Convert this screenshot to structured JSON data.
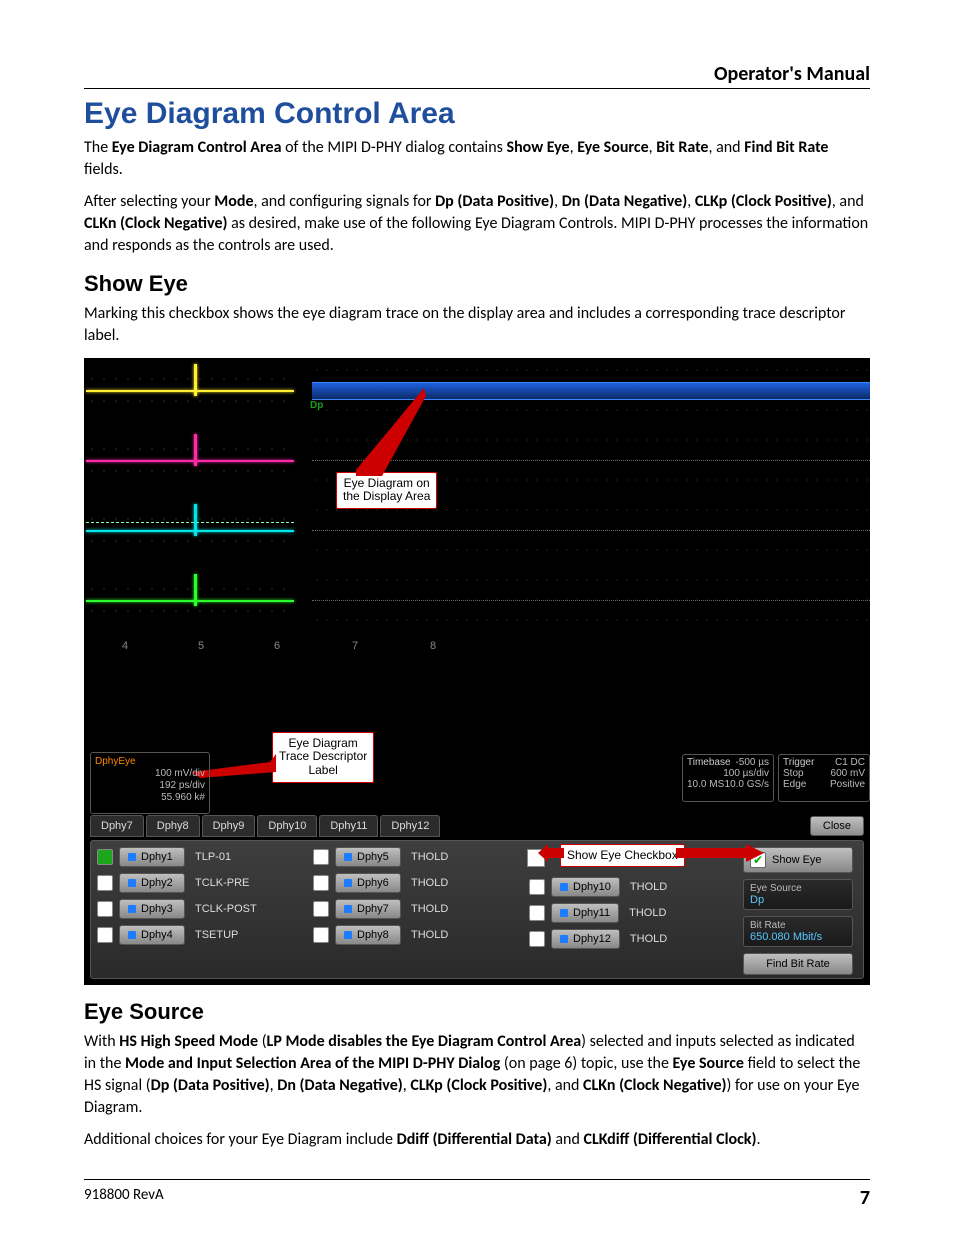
{
  "doc": {
    "category": "Operator's Manual",
    "title": "Eye Diagram Control Area",
    "p1a": "The ",
    "p1b": "Eye Diagram Control Area",
    "p1c": " of the MIPI D-PHY dialog contains ",
    "p1d": "Show Eye",
    "p1e": ", ",
    "p1f": "Eye Source",
    "p1g": ", ",
    "p1h": "Bit Rate",
    "p1i": ", and ",
    "p1j": "Find Bit Rate",
    "p1k": " fields.",
    "p2a": "After selecting your ",
    "p2b": "Mode",
    "p2c": ", and configuring signals for ",
    "p2d": "Dp (Data Positive)",
    "p2e": ", ",
    "p2f": "Dn (Data Negative)",
    "p2g": ", ",
    "p2h": "CLKp (Clock Positive)",
    "p2i": ", and ",
    "p2j": "CLKn (Clock Negative)",
    "p2k": " as desired, make use of the following Eye Diagram Controls. MIPI D-PHY processes the information and responds as the controls are used.",
    "h_showeye": "Show Eye",
    "p3": "Marking this checkbox shows the eye diagram trace on the display area and includes a corresponding trace descriptor label.",
    "h_eyesrc": "Eye Source",
    "p4a": "With ",
    "p4b": "HS High Speed Mode",
    "p4c": " (",
    "p4d": "LP Mode disables the Eye Diagram Control Area",
    "p4e": ") selected and inputs selected as indicated in the ",
    "p4f": "Mode and Input Selection Area of the MIPI D-PHY Dialog",
    "p4g": " (on page 6) topic, use the ",
    "p4h": "Eye Source",
    "p4i": " field to select the HS signal (",
    "p4j": "Dp (Data Positive)",
    "p4k": ", ",
    "p4l": "Dn (Data Negative)",
    "p4m": ", ",
    "p4n": "CLKp (Clock Positive)",
    "p4o": ", and ",
    "p4p": "CLKn (Clock Negative)",
    "p4q": ") for use on your Eye Diagram.",
    "p5a": "Additional choices for your Eye Diagram include ",
    "p5b": "Ddiff (Differential Data)",
    "p5c": " and ",
    "p5d": "CLKdiff (Differential Clock)",
    "p5e": ".",
    "footer_left": "918800 RevA",
    "footer_right": "7"
  },
  "shot": {
    "dp_label": "Dp",
    "xnums": [
      "4",
      "5",
      "6",
      "7",
      "8"
    ],
    "callout_display_l1": "Eye Diagram on",
    "callout_display_l2": "the Display Area",
    "callout_desc_l1": "Eye Diagram",
    "callout_desc_l2": "Trace Descriptor",
    "callout_desc_l3": "Label",
    "callout_checkbox": "Show Eye Checkbox",
    "desc_top": "DphyEye",
    "desc_l1": "100 mV/div",
    "desc_l2": "192 ps/div",
    "desc_l3": "55.960 k#",
    "timebase_h": "Timebase",
    "timebase_r1": "-500 µs",
    "timebase_r2": "100 µs/div",
    "timebase_r3": "10.0 GS/s",
    "timebase_l3": "10.0 MS",
    "trigger_h": "Trigger",
    "trigger_r1": "C1 DC",
    "trigger_l2": "Stop",
    "trigger_r2": "600 mV",
    "trigger_l3": "Edge",
    "trigger_r3": "Positive",
    "tabs": [
      "Dphy7",
      "Dphy8",
      "Dphy9",
      "Dphy10",
      "Dphy11",
      "Dphy12"
    ],
    "close": "Close",
    "colA": [
      {
        "lamp": "on",
        "name": "Dphy1",
        "val": "TLP-01"
      },
      {
        "lamp": "",
        "name": "Dphy2",
        "val": "TCLK-PRE"
      },
      {
        "lamp": "",
        "name": "Dphy3",
        "val": "TCLK-POST"
      },
      {
        "lamp": "",
        "name": "Dphy4",
        "val": "TSETUP"
      }
    ],
    "colB": [
      {
        "name": "Dphy5",
        "val": "THOLD"
      },
      {
        "name": "Dphy6",
        "val": "THOLD"
      },
      {
        "name": "Dphy7",
        "val": "THOLD"
      },
      {
        "name": "Dphy8",
        "val": "THOLD"
      }
    ],
    "colC": [
      {
        "name": "Dphy10",
        "val": "THOLD"
      },
      {
        "name": "Dphy11",
        "val": "THOLD"
      },
      {
        "name": "Dphy12",
        "val": "THOLD"
      }
    ],
    "show_eye_label": "Show Eye",
    "eye_src_label": "Eye Source",
    "eye_src_value": "Dp",
    "bitrate_label": "Bit Rate",
    "bitrate_value": "650.080 Mbit/s",
    "find_bitrate": "Find Bit Rate"
  }
}
